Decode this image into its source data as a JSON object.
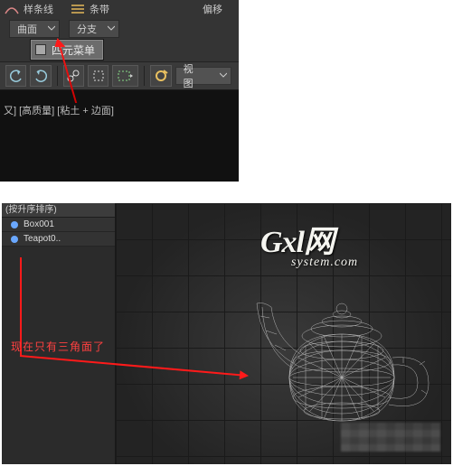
{
  "top": {
    "icon_label_1": "样条线",
    "icon_label_2": "条带",
    "right_label": "偏移",
    "dropdown1": "曲面",
    "dropdown2": "分支",
    "quad_menu": "四元菜单",
    "view_dropdown": "视图",
    "viewport_info": "又] [高质量] [粘土 + 边面]"
  },
  "explorer": {
    "header": "(按升序排序)",
    "items": [
      "Box001",
      "Teapot0.."
    ]
  },
  "watermark": {
    "main": "Gxl网",
    "sub": "system.com"
  },
  "annotation": "现在只有三角面了",
  "toolbar_icons": [
    "undo-icon",
    "redo-icon",
    "link-icon",
    "select-icon",
    "selection-region-icon",
    "circle-tool-icon"
  ]
}
